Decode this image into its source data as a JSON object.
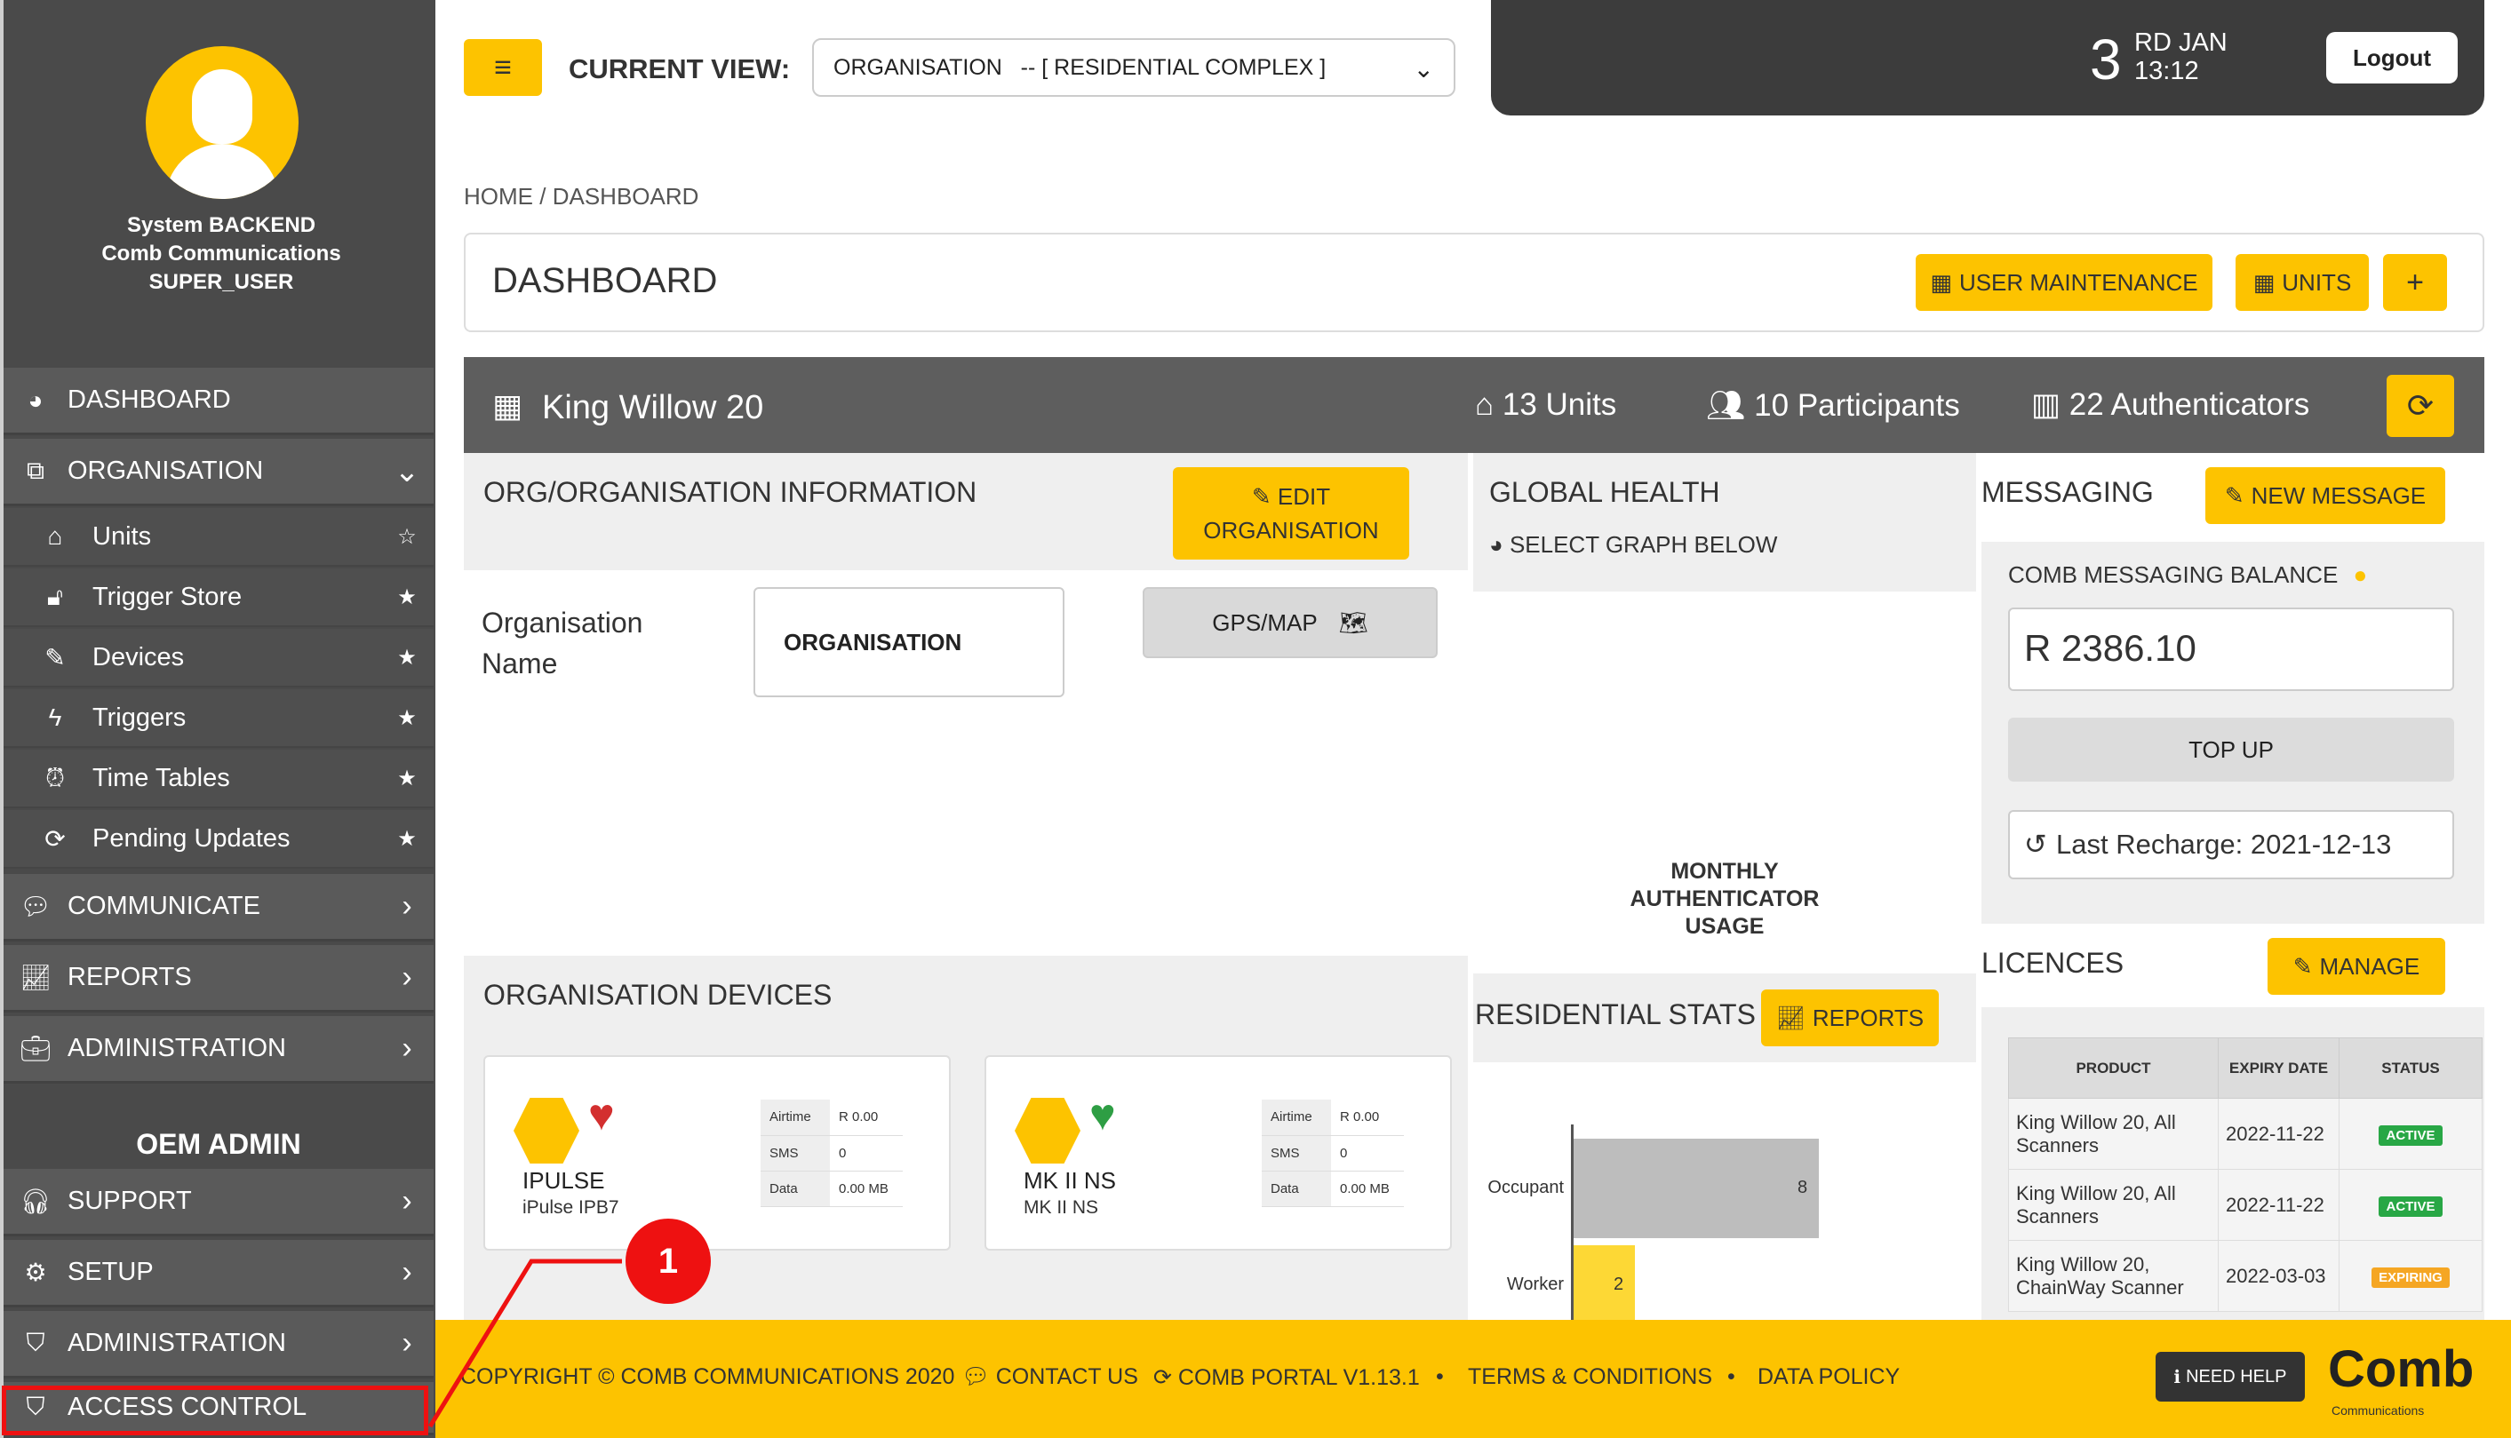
{
  "sidebar": {
    "user": [
      "System BACKEND",
      "Comb Communications",
      "SUPER_USER"
    ],
    "dashboard": "DASHBOARD",
    "organisation": "ORGANISATION",
    "sub_items": [
      "Units",
      "Trigger Store",
      "Devices",
      "Triggers",
      "Time Tables",
      "Pending Updates"
    ],
    "communicate": "COMMUNICATE",
    "reports": "REPORTS",
    "administration": "ADMINISTRATION",
    "oem_admin": "OEM ADMIN",
    "support": "SUPPORT",
    "setup": "SETUP",
    "administration2": "ADMINISTRATION",
    "access_control": "ACCESS CONTROL"
  },
  "topbar": {
    "menu_icon": "≡",
    "current_view_label": "CURRENT VIEW:",
    "current_view_value": "ORGANISATION   -- [ RESIDENTIAL COMPLEX ]",
    "date_day": "3",
    "date_month": "RD JAN",
    "time": "13:12",
    "logout": "Logout"
  },
  "breadcrumb": {
    "home": "HOME",
    "sep": "/",
    "current": "DASHBOARD"
  },
  "dashboard": {
    "title": "DASHBOARD",
    "user_maintenance": "USER MAINTENANCE",
    "units_btn": "UNITS",
    "plus": "+"
  },
  "org": {
    "name": "King Willow 20",
    "units": "13 Units",
    "participants": "10 Participants",
    "authenticators": "22 Authenticators"
  },
  "org_info": {
    "title": "ORG/ORGANISATION INFORMATION",
    "edit_line1": "EDIT",
    "edit_line2": "ORGANISATION",
    "name_label_1": "Organisation",
    "name_label_2": "Name",
    "name_value": "ORGANISATION",
    "gps": "GPS/MAP"
  },
  "devices": {
    "title": "ORGANISATION DEVICES",
    "items": [
      {
        "name": "IPULSE",
        "sub": "iPulse IPB7",
        "airtime": "R 0.00",
        "sms": "0",
        "data": "0.00 MB"
      },
      {
        "name": "MK II NS",
        "sub": "MK II NS",
        "airtime": "R 0.00",
        "sms": "0",
        "data": "0.00 MB"
      }
    ],
    "labels": {
      "airtime": "Airtime",
      "sms": "SMS",
      "data": "Data"
    }
  },
  "global_health": {
    "title": "GLOBAL HEALTH",
    "subtitle": "SELECT GRAPH BELOW",
    "chart_title_1": "MONTHLY",
    "chart_title_2": "AUTHENTICATOR",
    "chart_title_3": "USAGE"
  },
  "residential": {
    "title": "RESIDENTIAL STATS",
    "reports_btn": "REPORTS"
  },
  "chart_data": {
    "type": "bar",
    "orientation": "horizontal",
    "categories": [
      "Occupant",
      "Worker"
    ],
    "values": [
      8,
      2
    ],
    "colors": [
      "#bdbdbd",
      "#fdd835"
    ]
  },
  "messaging": {
    "title": "MESSAGING",
    "new_message": "NEW MESSAGE",
    "balance_label": "COMB MESSAGING BALANCE",
    "balance": "R 2386.10",
    "top_up": "TOP UP",
    "last_recharge": "Last Recharge: 2021-12-13"
  },
  "licences": {
    "title": "LICENCES",
    "manage": "MANAGE",
    "headers": [
      "PRODUCT",
      "EXPIRY DATE",
      "STATUS"
    ],
    "rows": [
      {
        "product": "King Willow 20, All Scanners",
        "expiry": "2022-11-22",
        "status": "ACTIVE"
      },
      {
        "product": "King Willow 20, All Scanners",
        "expiry": "2022-11-22",
        "status": "ACTIVE"
      },
      {
        "product": "King Willow 20, ChainWay Scanner",
        "expiry": "2022-03-03",
        "status": "EXPIRING"
      }
    ]
  },
  "footer": {
    "copyright": "COPYRIGHT © COMB COMMUNICATIONS 2020",
    "contact": "CONTACT US",
    "portal": "COMB PORTAL V1.13.1",
    "terms": "TERMS & CONDITIONS",
    "policy": "DATA POLICY",
    "help": "NEED HELP",
    "logo": "Comb",
    "logo_sub": "Communications"
  },
  "annotation": {
    "number": "1"
  },
  "colors": {
    "accent": "#fdc300",
    "sidebar": "#4a4a4a",
    "highlight": "#e11111",
    "active": "#28a745",
    "expiring": "#f5a623"
  }
}
